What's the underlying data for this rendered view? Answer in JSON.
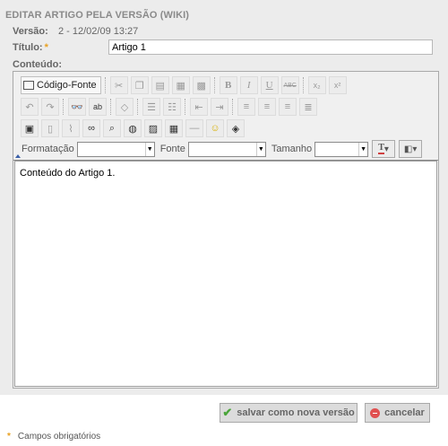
{
  "header": {
    "title": "EDITAR ARTIGO PELA VERSÃO (WIKI)"
  },
  "version": {
    "label": "Versão:",
    "value": "2 - 12/02/09 13:27"
  },
  "title_field": {
    "label": "Título:",
    "required_mark": "*",
    "value": "Artigo 1"
  },
  "content_field": {
    "label": "Conteúdo:"
  },
  "toolbar": {
    "source_button": "Código-Fonte",
    "bold": "B",
    "italic": "I",
    "underline": "U",
    "strike": "ABC",
    "subscript": "x₂",
    "superscript": "x²",
    "format_label": "Formatação",
    "font_label": "Fonte",
    "size_label": "Tamanho",
    "text_color_icon": "T",
    "icons": [
      "cut-icon",
      "copy-icon",
      "paste-icon",
      "paste-text-icon",
      "paste-word-icon",
      "undo-icon",
      "redo-icon",
      "find-icon",
      "replace-icon",
      "eraser-icon",
      "numbered-list-icon",
      "bulleted-list-icon",
      "outdent-icon",
      "indent-icon",
      "align-left-icon",
      "align-center-icon",
      "align-right-icon",
      "justify-icon",
      "image-icon",
      "page-icon",
      "attach-icon",
      "binoculars-icon",
      "magnifier-icon",
      "link-globe-icon",
      "picture-icon",
      "table-icon",
      "hr-icon",
      "smiley-icon",
      "special-char-icon"
    ]
  },
  "editor": {
    "content": "Conteúdo do Artigo 1."
  },
  "actions": {
    "save_label": "salvar como nova versão",
    "cancel_label": "cancelar"
  },
  "footer": {
    "required_mark": "*",
    "required_note": "Campos obrigatórios"
  },
  "colors": {
    "panel_bg": "#ececec",
    "required": "#e8a020",
    "save_icon": "#4aa53a",
    "cancel_icon": "#e05050"
  }
}
